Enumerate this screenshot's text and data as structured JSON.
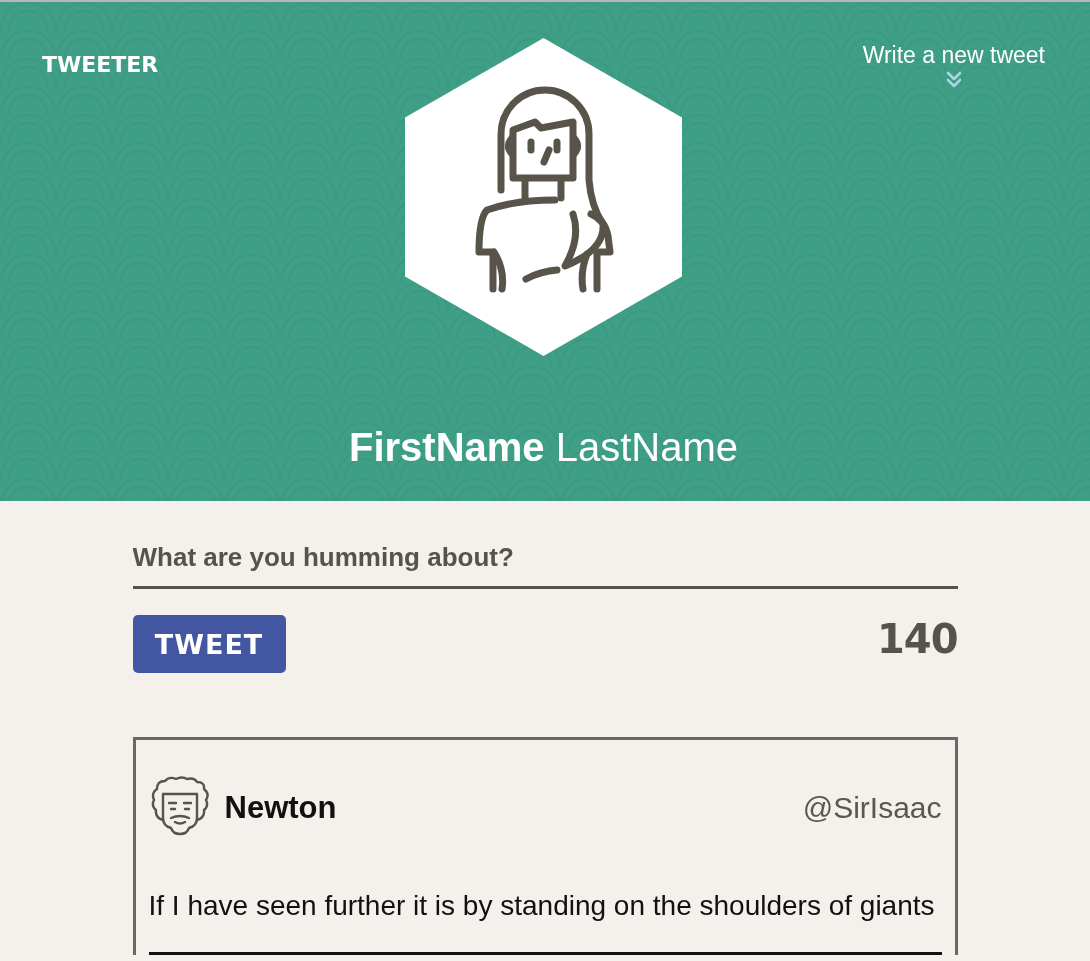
{
  "header": {
    "logo": "TWEETER",
    "compose_link": "Write a new tweet",
    "profile": {
      "name": "**FirstName** LastName"
    }
  },
  "composer": {
    "placeholder": "What are you humming about?",
    "button": "TWEET",
    "char_count": "140"
  },
  "tweets": [
    {
      "name": "Newton",
      "handle": "@SirIsaac",
      "text": "If I have seen further it is by standing on the shoulders of giants"
    }
  ]
}
